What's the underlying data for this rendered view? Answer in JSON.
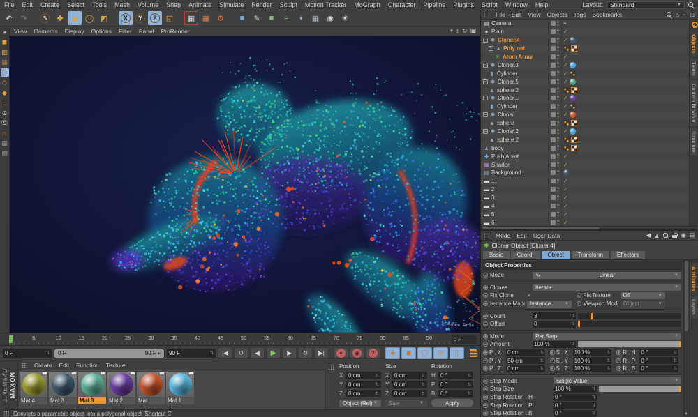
{
  "window": {
    "accent_orange": "#e6973a",
    "accent_blue": "#8fb3da",
    "viewport_bg": "#0d1130"
  },
  "menubar": {
    "items": [
      "File",
      "Edit",
      "Create",
      "Select",
      "Tools",
      "Mesh",
      "Volume",
      "Snap",
      "Animate",
      "Simulate",
      "Render",
      "Sculpt",
      "Motion Tracker",
      "MoGraph",
      "Character",
      "Pipeline",
      "Plugins",
      "Script",
      "Window",
      "Help"
    ],
    "layout_label": "Layout:",
    "layout_value": "Standard"
  },
  "toolbar": {
    "buttons": [
      {
        "name": "undo-button",
        "glyph": "↶",
        "fg": "#e0e0e0"
      },
      {
        "name": "redo-button",
        "glyph": "↷",
        "fg": "#757575"
      },
      {
        "name": "gap"
      },
      {
        "name": "live-selection-tool",
        "glyph": "↖",
        "fg": "#e8e8e8",
        "ring": true
      },
      {
        "name": "move-tool",
        "glyph": "✚",
        "fg": "#e2a33c"
      },
      {
        "name": "scale-tool",
        "glyph": "◼",
        "fg": "#e2a33c",
        "active": true
      },
      {
        "name": "rotate-tool",
        "glyph": "◯",
        "fg": "#e2a33c"
      },
      {
        "name": "last-used-tool",
        "glyph": "◩",
        "fg": "#e2a33c"
      },
      {
        "name": "gap"
      },
      {
        "name": "x-axis-lock-toggle",
        "glyph": "X",
        "fg": "#2b2b2b",
        "ring": true,
        "active": true
      },
      {
        "name": "y-axis-lock-toggle",
        "glyph": "Y",
        "fg": "#e8e8e8",
        "ring": true
      },
      {
        "name": "z-axis-lock-toggle",
        "glyph": "Z",
        "fg": "#2b2b2b",
        "ring": true,
        "active": true
      },
      {
        "name": "coordinate-system-toggle",
        "glyph": "◱",
        "fg": "#e2a33c"
      },
      {
        "name": "gap"
      },
      {
        "name": "render-view-button",
        "glyph": "▦",
        "fg": "#d8d8d8",
        "border": "#b4472a"
      },
      {
        "name": "render-picture-viewer-button",
        "glyph": "▦",
        "fg": "#e2763c"
      },
      {
        "name": "render-settings-button",
        "glyph": "⚙",
        "fg": "#e2763c"
      },
      {
        "name": "gap"
      },
      {
        "name": "add-cube-object-button",
        "glyph": "■",
        "fg": "#6fa8dc"
      },
      {
        "name": "add-spline-button",
        "glyph": "✎",
        "fg": "#d8d8d8"
      },
      {
        "name": "add-subdivision-surface-button",
        "glyph": "■",
        "fg": "#7bbf6a"
      },
      {
        "name": "add-deformer-button",
        "glyph": "≈",
        "fg": "#7bbf6a"
      },
      {
        "name": "add-environment-button",
        "glyph": "◖",
        "fg": "#8fb8e0"
      },
      {
        "name": "add-floor-button",
        "glyph": "▦",
        "fg": "#a8b8c8"
      },
      {
        "name": "add-camera-button",
        "glyph": "◉",
        "fg": "#d0d0d0"
      },
      {
        "name": "add-light-button",
        "glyph": "☀",
        "fg": "#e8e2b8"
      }
    ]
  },
  "left_rail": {
    "buttons": [
      {
        "name": "display-filter-icon",
        "glyph": "◕",
        "fg": "#cccccc"
      },
      {
        "name": "model-mode-button",
        "glyph": "◼",
        "fg": "#e2a33c"
      },
      {
        "name": "texture-mode-button",
        "glyph": "▨",
        "fg": "#e2a33c"
      },
      {
        "name": "workplane-mode-button",
        "glyph": "▦",
        "fg": "#b08a50"
      },
      {
        "name": "points-mode-button",
        "glyph": "∷",
        "fg": "#e2a33c",
        "active": true
      },
      {
        "name": "edge-mode-button",
        "glyph": "◇",
        "fg": "#e2a33c"
      },
      {
        "name": "polygon-mode-button",
        "glyph": "◆",
        "fg": "#e2a33c"
      },
      {
        "name": "axis-mode-button",
        "glyph": "∟",
        "fg": "#e2a33c"
      },
      {
        "name": "viewport-solo-button",
        "glyph": "⊙",
        "fg": "#cccccc"
      },
      {
        "name": "snap-toggle-button",
        "glyph": "Ⓢ",
        "fg": "#cccccc"
      },
      {
        "name": "magnet-snap-button",
        "glyph": "∩",
        "fg": "#e2763c"
      },
      {
        "name": "workplane-lock-button",
        "glyph": "▦",
        "fg": "#9a9a9a"
      },
      {
        "name": "workplane-align-button",
        "glyph": "▧",
        "fg": "#9a9a9a"
      }
    ]
  },
  "viewport": {
    "menu_items": [
      "View",
      "Cameras",
      "Display",
      "Options",
      "Filter",
      "Panel",
      "ProRender"
    ],
    "corner_icons": [
      {
        "name": "viewport-pan-icon",
        "glyph": "+"
      },
      {
        "name": "viewport-zoom-icon",
        "glyph": "↕"
      },
      {
        "name": "viewport-rotate-icon",
        "glyph": "↻"
      },
      {
        "name": "viewport-toggle-icon",
        "glyph": "▣"
      }
    ],
    "credit": "© Fabian Aerts",
    "palette": {
      "teal": [
        "#2fe3c3",
        "#35d9a2",
        "#29b8d8",
        "#3fe08a",
        "#27c7e8",
        "#1fae9e"
      ],
      "cyan": [
        "#2fd7e8",
        "#35b9f0",
        "#2a9fe0",
        "#45e8d0",
        "#35e0c8"
      ],
      "purple": [
        "#6a3cf0",
        "#4a3ce0",
        "#8a3cf0",
        "#3a55e8",
        "#5a2fd0",
        "#3333b8"
      ],
      "blue": [
        "#2fb0d8",
        "#3a6fe8",
        "#35d9b2",
        "#4a4ae0",
        "#2a8fd0"
      ],
      "float": [
        "#2fd7c8",
        "#35c9e0",
        "#3fe0a8",
        "#49c8e8"
      ],
      "spark_orange": "#ff5a1f",
      "spark_yellow": "#ffd23f",
      "spike": "#ff4416",
      "accent": "#ff4d14"
    }
  },
  "timeline": {
    "ticks": [
      "0",
      "5",
      "10",
      "15",
      "20",
      "25",
      "30",
      "35",
      "40",
      "45",
      "50",
      "55",
      "60",
      "65",
      "70",
      "75",
      "80",
      "85",
      "90"
    ],
    "frame_label": "0 F"
  },
  "transport": {
    "start_frame": "0 F",
    "range_start": "0 F",
    "range_end": "90 F ▸",
    "end_frame": "90 F",
    "nav_buttons": [
      {
        "name": "goto-start-button",
        "glyph": "|◀"
      },
      {
        "name": "play-reverse-button",
        "glyph": "↺"
      },
      {
        "name": "previous-frame-button",
        "glyph": "◀"
      },
      {
        "name": "play-forward-button",
        "glyph": "▶",
        "green": true
      },
      {
        "name": "next-frame-button",
        "glyph": "▶"
      },
      {
        "name": "loop-mode-button",
        "glyph": "↻"
      },
      {
        "name": "goto-end-button",
        "glyph": "▶|"
      }
    ],
    "record_buttons": [
      {
        "name": "record-keyframe-button",
        "glyph": "✦"
      },
      {
        "name": "autokey-toggle-button",
        "glyph": "◉"
      },
      {
        "name": "keying-help-button",
        "glyph": "?"
      }
    ],
    "key_toggles": [
      {
        "name": "record-position-toggle",
        "glyph": "✚"
      },
      {
        "name": "record-scale-toggle",
        "glyph": "◼"
      },
      {
        "name": "record-rotation-toggle",
        "glyph": "◯"
      },
      {
        "name": "record-parameter-toggle",
        "glyph": "Ⓟ"
      },
      {
        "name": "record-pla-toggle",
        "glyph": "⣿"
      }
    ]
  },
  "materials": {
    "menu": [
      "Create",
      "Edit",
      "Function",
      "Texture"
    ],
    "items": [
      {
        "label": "Mat.4",
        "color": "#9a9b33",
        "selected": false
      },
      {
        "label": "Mat.3",
        "color": "#3f5a6e",
        "selected": false
      },
      {
        "label": "Mat.3",
        "color": "#5fb09a",
        "selected": true
      },
      {
        "label": "Mat.2",
        "color": "#6b3fa0",
        "selected": false
      },
      {
        "label": "Mat",
        "color": "#c5552e",
        "selected": false
      },
      {
        "label": "Mat.1",
        "color": "#58b5dc",
        "selected": false
      }
    ]
  },
  "coordinates": {
    "columns": [
      "Position",
      "Size",
      "Rotation"
    ],
    "rows": [
      [
        {
          "l": "X",
          "v": "0 cm"
        },
        {
          "l": "X",
          "v": "0 cm"
        },
        {
          "l": "H",
          "v": "0 °"
        }
      ],
      [
        {
          "l": "Y",
          "v": "0 cm"
        },
        {
          "l": "Y",
          "v": "0 cm"
        },
        {
          "l": "P",
          "v": "0 °"
        }
      ],
      [
        {
          "l": "Z",
          "v": "0 cm"
        },
        {
          "l": "Z",
          "v": "0 cm"
        },
        {
          "l": "B",
          "v": "0 °"
        }
      ]
    ],
    "mode_dropdown": "Object (Rel)",
    "size_dropdown": "Size",
    "apply_label": "Apply"
  },
  "object_manager": {
    "menu": [
      "File",
      "Edit",
      "View",
      "Objects",
      "Tags",
      "Bookmarks"
    ],
    "side_tabs": [
      {
        "label": "Objects",
        "active": true
      },
      {
        "label": "Takes",
        "active": false
      },
      {
        "label": "Content Browser",
        "active": false
      },
      {
        "label": "Structure",
        "active": false
      }
    ],
    "items": [
      {
        "name": "Camera",
        "depth": 0,
        "icon": "camera",
        "dots": true,
        "extra": "target"
      },
      {
        "name": "Plain",
        "depth": 0,
        "icon": "plain",
        "dots": true,
        "check": true
      },
      {
        "name": "Cloner.4",
        "depth": 0,
        "icon": "cloner",
        "expand": "minus",
        "selected": true,
        "dots": true,
        "check": true,
        "mat": "#3f5a6e"
      },
      {
        "name": "Poly net",
        "depth": 1,
        "icon": "cone",
        "expand": "plus",
        "selected": true,
        "dots": true,
        "chips": [
          "dots",
          "checker"
        ]
      },
      {
        "name": "Atom Array",
        "depth": 2,
        "icon": "atom",
        "selected": true,
        "dots": true,
        "check": true
      },
      {
        "name": "Cloner.3",
        "depth": 0,
        "icon": "cloner",
        "expand": "minus",
        "dots": true,
        "check": true,
        "mat": "#4fa6d4"
      },
      {
        "name": "Cylinder",
        "depth": 1,
        "icon": "cylinder",
        "dots": true,
        "check": true,
        "chips": [
          "dots"
        ]
      },
      {
        "name": "Cloner.5",
        "depth": 0,
        "icon": "cloner",
        "expand": "minus",
        "dots": true,
        "check": true,
        "mat": "#53a08c"
      },
      {
        "name": "sphere 2",
        "depth": 1,
        "icon": "cone",
        "dots": true,
        "chips": [
          "dots",
          "checker"
        ]
      },
      {
        "name": "Cloner.1",
        "depth": 0,
        "icon": "cloner",
        "expand": "minus",
        "dots": true,
        "check": true,
        "mat": "#6b3fa0"
      },
      {
        "name": "Cylinder",
        "depth": 1,
        "icon": "cylinder",
        "dots": true,
        "check": true,
        "chips": [
          "dots"
        ]
      },
      {
        "name": "Cloner",
        "depth": 0,
        "icon": "cloner",
        "expand": "minus",
        "dots": true,
        "check": true,
        "mat": "#c5552e"
      },
      {
        "name": "sphere",
        "depth": 1,
        "icon": "cone",
        "dots": true,
        "chips": [
          "dots",
          "checker"
        ]
      },
      {
        "name": "Cloner.2",
        "depth": 0,
        "icon": "cloner",
        "expand": "minus",
        "dots": true,
        "check": true,
        "mat": "#4fa6d4"
      },
      {
        "name": "sphere 2",
        "depth": 1,
        "icon": "cone",
        "dots": true,
        "chips": [
          "dots",
          "checker"
        ]
      },
      {
        "name": "body",
        "depth": 0,
        "icon": "cone",
        "dots": true,
        "chips": [
          "dots",
          "checker"
        ]
      },
      {
        "name": "Push Apart",
        "depth": 0,
        "icon": "push",
        "dots": true,
        "check": true
      },
      {
        "name": "Shader",
        "depth": 0,
        "icon": "shader",
        "dots": true,
        "check": true
      },
      {
        "name": "Background",
        "depth": 0,
        "icon": "background",
        "dots": true,
        "mat": "#39536e"
      },
      {
        "name": "1",
        "depth": 0,
        "icon": "null",
        "dots": true,
        "check": true
      },
      {
        "name": "2",
        "depth": 0,
        "icon": "null",
        "dots": true,
        "check": true
      },
      {
        "name": "3",
        "depth": 0,
        "icon": "null",
        "dots": true,
        "check": true
      },
      {
        "name": "4",
        "depth": 0,
        "icon": "null",
        "dots": true,
        "check": true
      },
      {
        "name": "5",
        "depth": 0,
        "icon": "null",
        "dots": true,
        "check": true
      },
      {
        "name": "6",
        "depth": 0,
        "icon": "null",
        "dots": true,
        "check": true
      }
    ]
  },
  "attribute_manager": {
    "menu": [
      "Mode",
      "Edit",
      "User Data"
    ],
    "title": "Cloner Object [Cloner.4]",
    "tabs": [
      {
        "label": "Basic",
        "active": false
      },
      {
        "label": "Coord.",
        "active": false
      },
      {
        "label": "Object",
        "active": true
      },
      {
        "label": "Transform",
        "active": false
      },
      {
        "label": "Effectors",
        "active": false
      }
    ],
    "section": "Object Properties",
    "side_tabs": [
      {
        "label": "Attributes",
        "active": true
      },
      {
        "label": "Layers",
        "active": false
      }
    ],
    "rows": [
      {
        "type": "dropdown",
        "label": "Mode",
        "value": "Linear",
        "icon": "∿"
      },
      {
        "type": "sep"
      },
      {
        "type": "dropdown",
        "label": "Clones",
        "value": "Iterate"
      },
      {
        "type": "pair",
        "left": {
          "kind": "check",
          "label": "Fix Clone",
          "checked": true
        },
        "right": {
          "kind": "dropdown",
          "label": "Fix Texture",
          "value": "Off"
        }
      },
      {
        "type": "pair",
        "left": {
          "kind": "dropdown",
          "label": "Instance Mode",
          "value": "Instance"
        },
        "right": {
          "kind": "dropdown",
          "label": "Viewport Mode",
          "value": "Object",
          "disabled": true
        }
      },
      {
        "type": "sep"
      },
      {
        "type": "slider",
        "label": "Count",
        "value": "3",
        "fill": 14
      },
      {
        "type": "slider",
        "label": "Offset",
        "value": "0",
        "fill": 2
      },
      {
        "type": "sep"
      },
      {
        "type": "dropdown",
        "label": "Mode",
        "value": "Per Step"
      },
      {
        "type": "slider",
        "label": "Amount",
        "value": "100 %",
        "fill": 100
      },
      {
        "type": "triple",
        "cells": [
          {
            "label": "P . X",
            "value": "0 cm"
          },
          {
            "label": "S . X",
            "value": "100 %"
          },
          {
            "label": "R . H",
            "value": "0 °"
          }
        ]
      },
      {
        "type": "triple",
        "cells": [
          {
            "label": "P . Y",
            "value": "50 cm"
          },
          {
            "label": "S . Y",
            "value": "100 %"
          },
          {
            "label": "R . P",
            "value": "0 °"
          }
        ]
      },
      {
        "type": "triple",
        "cells": [
          {
            "label": "P . Z",
            "value": "0 cm"
          },
          {
            "label": "S . Z",
            "value": "100 %"
          },
          {
            "label": "R . B",
            "value": "0 °"
          }
        ]
      },
      {
        "type": "sep"
      },
      {
        "type": "dropdown",
        "label": "Step Mode",
        "value": "Single Value",
        "wide": true
      },
      {
        "type": "slider",
        "label": "Step Size",
        "value": "100 %",
        "fill": 100,
        "wide": true
      },
      {
        "type": "field",
        "label": "Step Rotation . H",
        "value": "0 °",
        "wide": true
      },
      {
        "type": "field",
        "label": "Step Rotation . P",
        "value": "0 °",
        "wide": true
      },
      {
        "type": "field",
        "label": "Step Rotation . B",
        "value": "0 °",
        "wide": true
      }
    ]
  },
  "branding": {
    "maxon": "MAXON",
    "cinema": "CINEMA4D"
  },
  "status_bar": {
    "text": "Converts a parametric object into a polygonal object [Shortcut C]"
  }
}
